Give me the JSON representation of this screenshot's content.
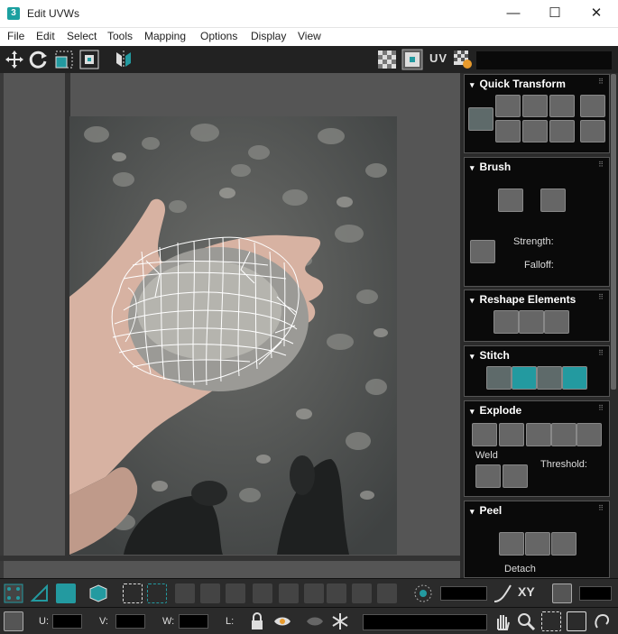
{
  "window": {
    "title": "Edit UVWs",
    "app_icon_glyph": "3",
    "minimize_glyph": "—",
    "maximize_glyph": "☐",
    "close_glyph": "✕"
  },
  "menu": {
    "items": [
      "File",
      "Edit",
      "Select",
      "Tools",
      "Mapping",
      "Options",
      "Display",
      "View"
    ]
  },
  "toolbar": {
    "uv_label": "UV",
    "icons": [
      "move-icon",
      "rotate-icon",
      "scale-icon",
      "freeform-icon",
      "mirror-icon",
      "checker-icon",
      "checker-pattern-icon",
      "texture-settings-icon"
    ]
  },
  "panel": {
    "quick_transform": {
      "title": "Quick Transform"
    },
    "brush": {
      "title": "Brush",
      "strength_label": "Strength:",
      "falloff_label": "Falloff:"
    },
    "reshape": {
      "title": "Reshape Elements"
    },
    "stitch": {
      "title": "Stitch"
    },
    "explode": {
      "title": "Explode",
      "weld_label": "Weld",
      "threshold_label": "Threshold:"
    },
    "peel": {
      "title": "Peel",
      "detach_label": "Detach"
    },
    "grip_glyph": "⠿"
  },
  "bottom": {
    "u_label": "U:",
    "v_label": "V:",
    "w_label": "W:",
    "l_label": "L:",
    "xy_label": "XY"
  },
  "colors": {
    "accent": "#239aa0",
    "panel_bg": "#0a0a0a",
    "toolbar_bg": "#2b2b2b",
    "uv_wire": "#ffffff"
  }
}
